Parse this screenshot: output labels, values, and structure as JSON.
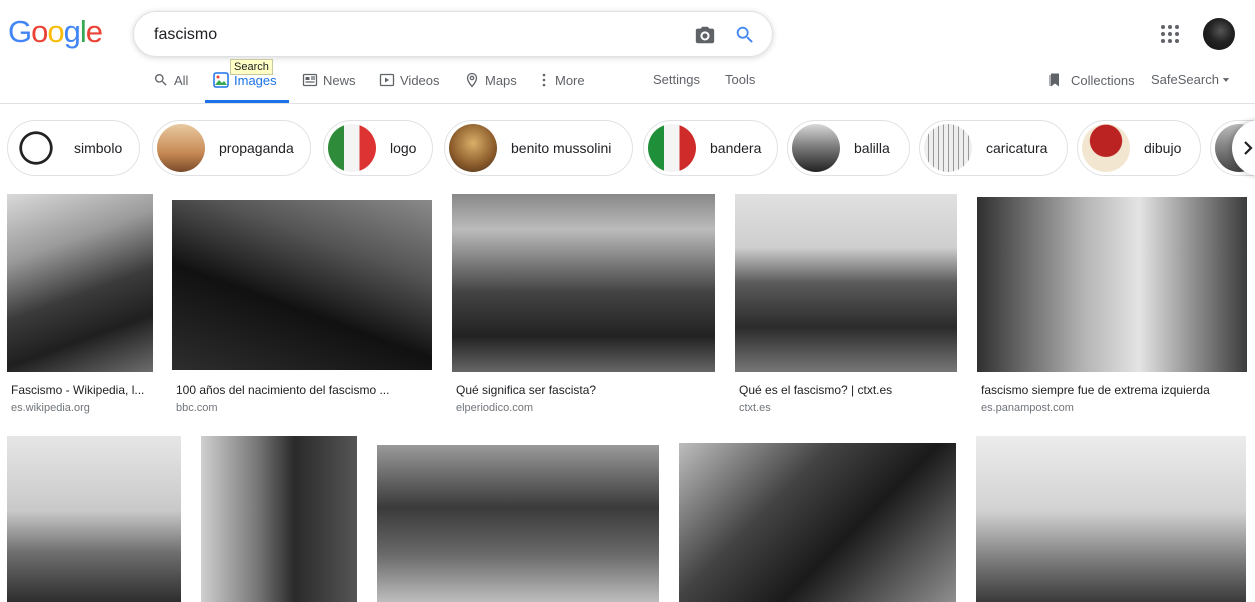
{
  "logo": {
    "letters": [
      "G",
      "o",
      "o",
      "g",
      "l",
      "e"
    ],
    "colors": [
      "#4285F4",
      "#EA4335",
      "#FBBC05",
      "#4285F4",
      "#34A853",
      "#EA4335"
    ]
  },
  "search": {
    "query": "fascismo",
    "tooltip": "Search"
  },
  "tabs": [
    {
      "label": "All"
    },
    {
      "label": "Images"
    },
    {
      "label": "News"
    },
    {
      "label": "Videos"
    },
    {
      "label": "Maps"
    },
    {
      "label": "More"
    }
  ],
  "tools": {
    "settings": "Settings",
    "tools": "Tools",
    "collections": "Collections",
    "safesearch": "SafeSearch"
  },
  "chips": [
    "simbolo",
    "propaganda",
    "logo",
    "benito mussolini",
    "bandera",
    "balilla",
    "caricatura",
    "dibujo"
  ],
  "results": [
    {
      "title": "Fascismo - Wikipedia, l...",
      "source": "es.wikipedia.org"
    },
    {
      "title": "100 años del nacimiento del fascismo ...",
      "source": "bbc.com"
    },
    {
      "title": "Qué significa ser fascista?",
      "source": "elperiodico.com"
    },
    {
      "title": "Qué es el fascismo? | ctxt.es",
      "source": "ctxt.es"
    },
    {
      "title": "fascismo siempre fue de extrema izquierda",
      "source": "es.panampost.com"
    }
  ],
  "colors": {
    "accent": "#1a73e8",
    "muted": "#5f6368",
    "border": "#dfe1e5"
  }
}
